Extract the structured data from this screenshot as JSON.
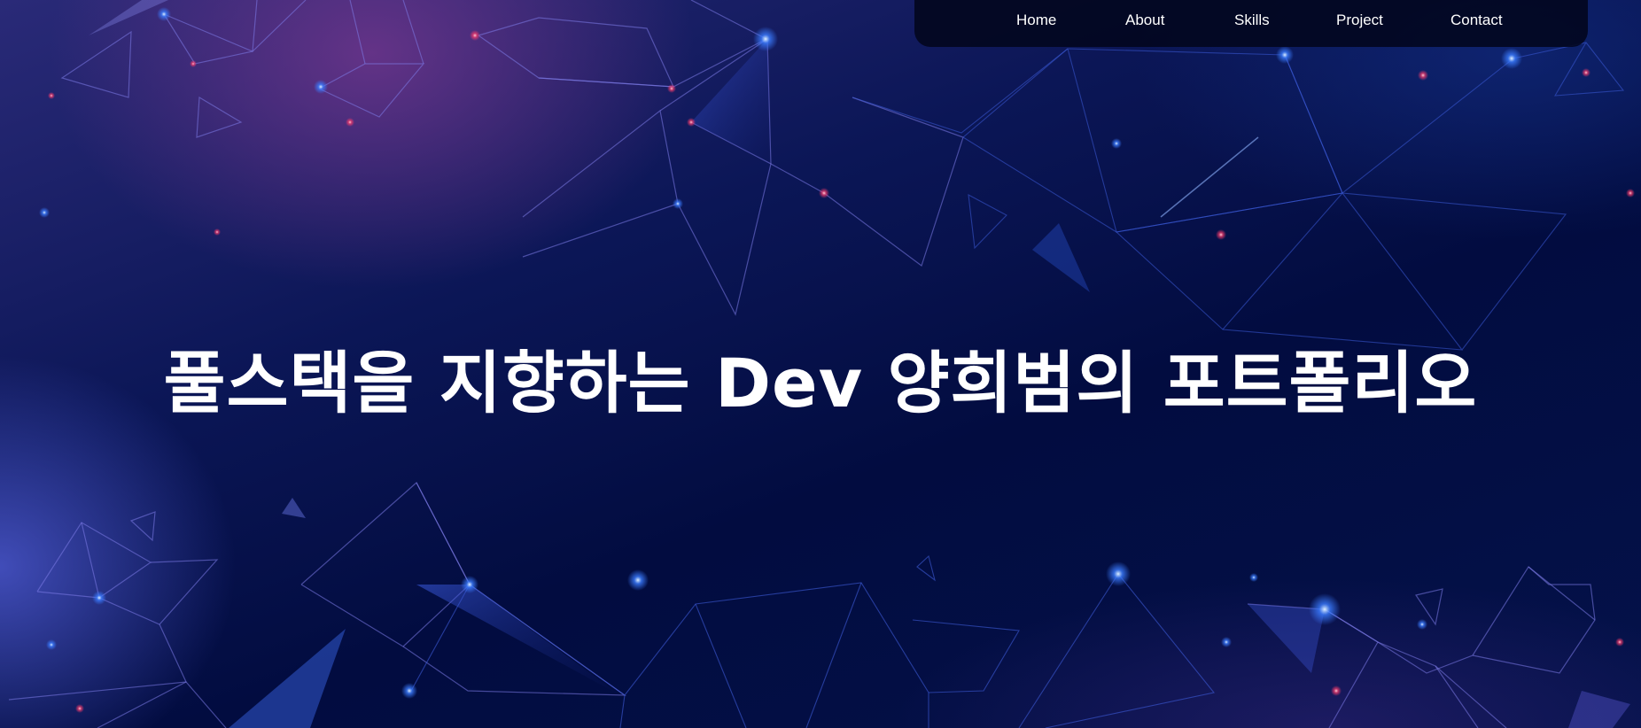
{
  "nav": {
    "items": [
      {
        "label": "Home"
      },
      {
        "label": "About"
      },
      {
        "label": "Skills"
      },
      {
        "label": "Project"
      },
      {
        "label": "Contact"
      }
    ]
  },
  "hero": {
    "title": "풀스택을 지향하는 Dev 양희범의 포트폴리오"
  },
  "colors": {
    "background": "#030d3f",
    "nav_background": "#02061c",
    "text": "#ffffff",
    "line": "#4a63d6",
    "glow_blue": "#3a7bff",
    "glow_red": "#ff3b6b"
  }
}
